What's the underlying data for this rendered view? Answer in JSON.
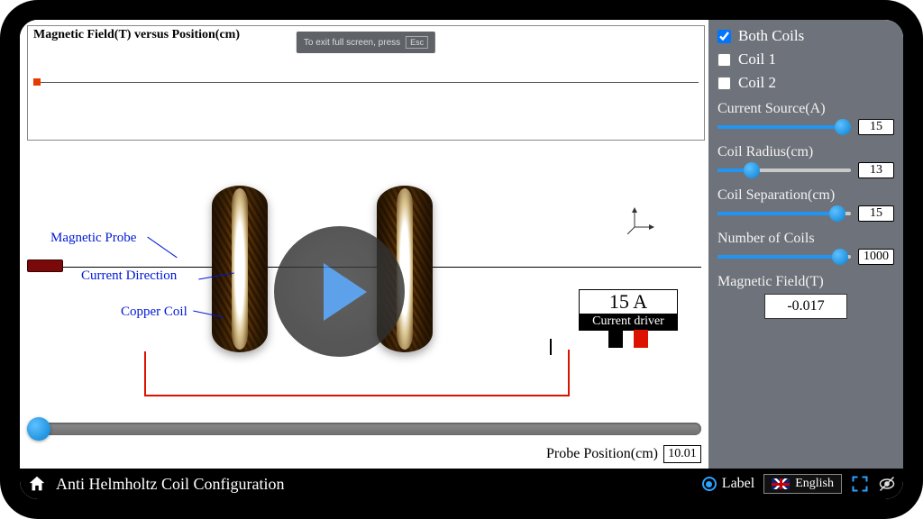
{
  "chart": {
    "title": "Magnetic Field(T) versus Position(cm)"
  },
  "fullscreen_hint": {
    "text": "To exit full screen, press",
    "key": "Esc"
  },
  "scene_labels": {
    "probe": "Magnetic Probe",
    "direction": "Current Direction",
    "coil": "Copper Coil"
  },
  "driver": {
    "reading": "15 A",
    "caption": "Current driver"
  },
  "probe_position": {
    "label": "Probe Position(cm)",
    "value": "10.01"
  },
  "checkboxes": {
    "both": {
      "label": "Both Coils",
      "checked": true
    },
    "coil1": {
      "label": "Coil 1",
      "checked": false
    },
    "coil2": {
      "label": "Coil 2",
      "checked": false
    }
  },
  "params": {
    "current": {
      "label": "Current Source(A)",
      "value": "15",
      "fill_pct": 94
    },
    "radius": {
      "label": "Coil Radius(cm)",
      "value": "13",
      "fill_pct": 26
    },
    "sep": {
      "label": "Coil Separation(cm)",
      "value": "15",
      "fill_pct": 90
    },
    "turns": {
      "label": "Number of Coils",
      "value": "1000",
      "fill_pct": 92
    }
  },
  "output": {
    "label": "Magnetic Field(T)",
    "value": "-0.017"
  },
  "footer": {
    "title": "Anti Helmholtz Coil Configuration",
    "label_toggle": "Label",
    "language": "English"
  },
  "chart_data": {
    "type": "line",
    "title": "Magnetic Field(T) versus Position(cm)",
    "xlabel": "Position (cm)",
    "ylabel": "Magnetic Field (T)",
    "x": [
      10.01
    ],
    "series": [
      {
        "name": "Both Coils",
        "values": [
          -0.017
        ]
      }
    ],
    "note": "Only a single plotted point is visible at the start of the trace."
  }
}
